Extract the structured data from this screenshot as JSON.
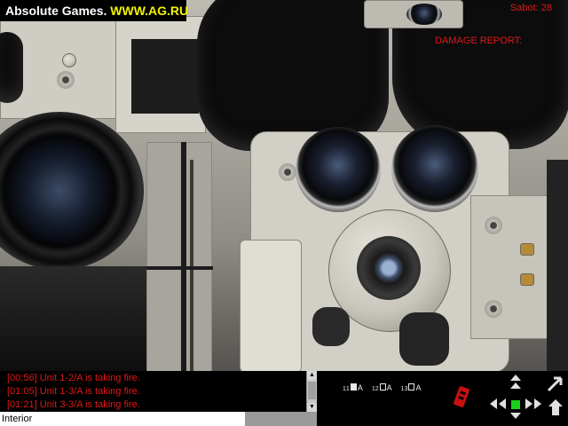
{
  "overlay": {
    "watermark_text": "Absolute Games.",
    "watermark_url": "WWW.AG.RU",
    "ammo": "Sabot: 28",
    "damage_report": "DAMAGE REPORT:"
  },
  "message_log": [
    "[00:56] Unit 1-2/A is taking fire.",
    "[01:05] Unit 1-3/A is taking fire.",
    "[01:21] Unit 3-3/A is taking fire."
  ],
  "status_bar": {
    "text": "Interior"
  },
  "units": [
    {
      "num": "1",
      "sub": "1",
      "letter": "A",
      "selected": true
    },
    {
      "num": "1",
      "sub": "2",
      "letter": "A",
      "selected": false
    },
    {
      "num": "1",
      "sub": "3",
      "letter": "A",
      "selected": false
    }
  ],
  "colors": {
    "hud_text": "#e01818",
    "watermark_url": "#f4f400",
    "center_button": "#18d018"
  },
  "icons": [
    "radio-handset-icon",
    "move-up-icon",
    "move-down-icon",
    "turn-left-icon",
    "turn-right-icon",
    "move-forward-icon",
    "move-backward-icon",
    "center-view-icon",
    "exit-vehicle-icon",
    "cursor-icon"
  ]
}
